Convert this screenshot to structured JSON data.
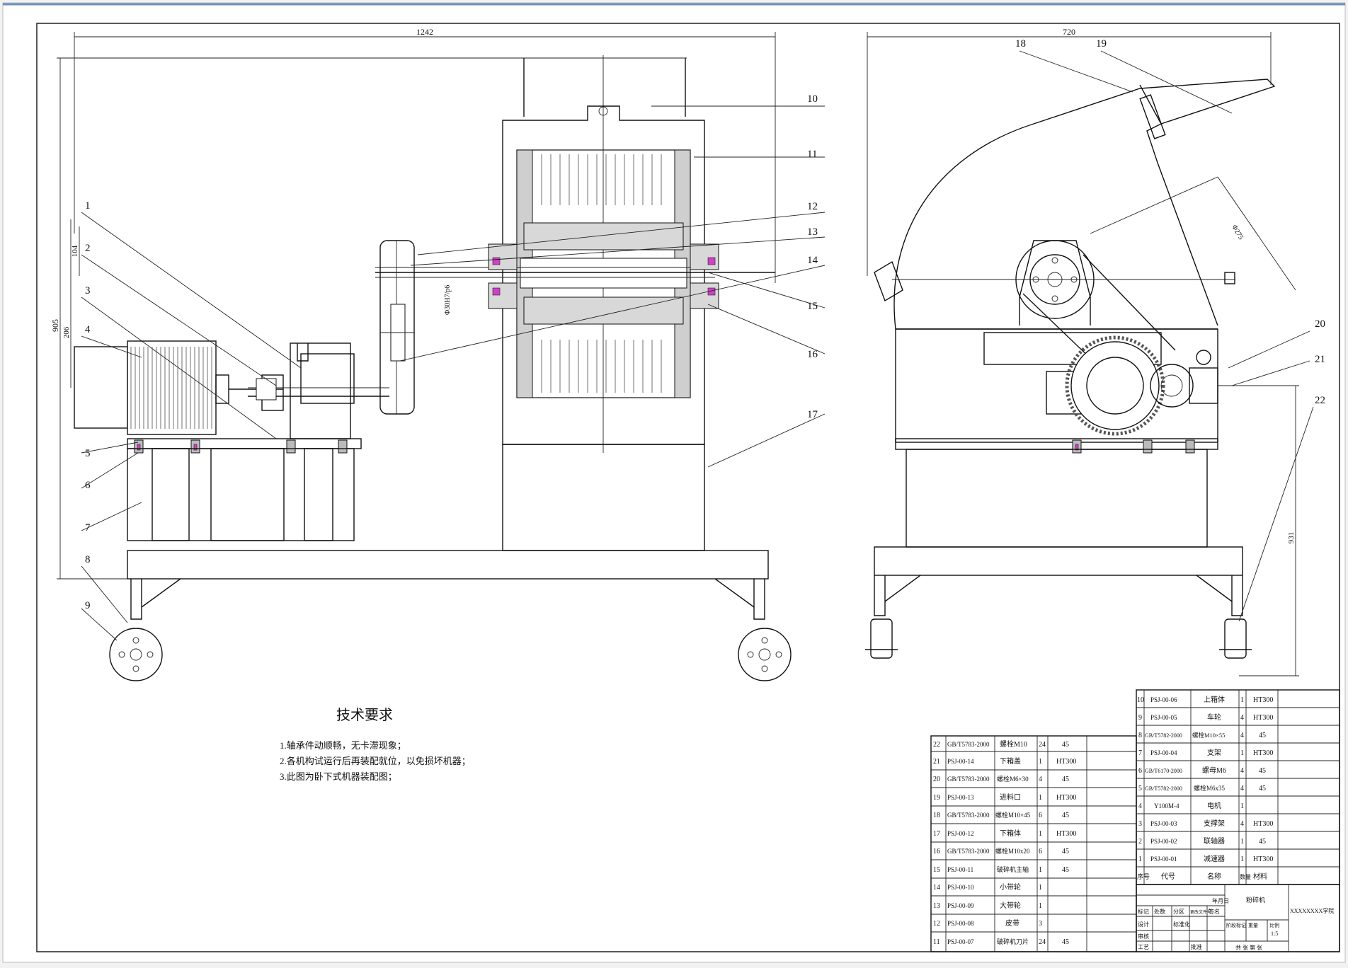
{
  "drawing": {
    "dims": {
      "overall_width": "1242",
      "right_width": "720",
      "total_height": "905",
      "motor_height": "206",
      "shaft_height": "104",
      "fit_lower": "Φ30H7/p6",
      "right_diag": "Φ275",
      "right_height": "931"
    },
    "balloons": [
      "1",
      "2",
      "3",
      "4",
      "5",
      "6",
      "7",
      "8",
      "9",
      "10",
      "11",
      "12",
      "13",
      "14",
      "15",
      "16",
      "17",
      "18",
      "19",
      "20",
      "21",
      "22"
    ],
    "tech_requirements": {
      "title": "技术要求",
      "items": [
        "1.轴承件动顺畅，无卡滞现象；",
        "2.各机构试运行后再装配就位，以免损坏机器；",
        "3.此图为卧下式机器装配图；"
      ]
    },
    "bom_left": [
      {
        "no": "22",
        "code": "GB/T5783-2000",
        "name": "螺栓M10",
        "qty": "24",
        "mat": "45"
      },
      {
        "no": "21",
        "code": "PSJ-00-14",
        "name": "下箱盖",
        "qty": "1",
        "mat": "HT300"
      },
      {
        "no": "20",
        "code": "GB/T5783-2000",
        "name": "螺栓M6×30",
        "qty": "4",
        "mat": "45"
      },
      {
        "no": "19",
        "code": "PSJ-00-13",
        "name": "进料口",
        "qty": "1",
        "mat": "HT300"
      },
      {
        "no": "18",
        "code": "GB/T5783-2000",
        "name": "螺栓M10×45",
        "qty": "6",
        "mat": "45"
      },
      {
        "no": "17",
        "code": "PSJ-00-12",
        "name": "下箱体",
        "qty": "1",
        "mat": "HT300"
      },
      {
        "no": "16",
        "code": "GB/T5783-2000",
        "name": "螺栓M10x20",
        "qty": "6",
        "mat": "45"
      },
      {
        "no": "15",
        "code": "PSJ-00-11",
        "name": "破碎机主轴",
        "qty": "1",
        "mat": "45"
      },
      {
        "no": "14",
        "code": "PSJ-00-10",
        "name": "小带轮",
        "qty": "1",
        "mat": ""
      },
      {
        "no": "13",
        "code": "PSJ-00-09",
        "name": "大带轮",
        "qty": "1",
        "mat": ""
      },
      {
        "no": "12",
        "code": "PSJ-00-08",
        "name": "皮带",
        "qty": "3",
        "mat": ""
      },
      {
        "no": "11",
        "code": "PSJ-00-07",
        "name": "破碎机刀片",
        "qty": "24",
        "mat": "45"
      }
    ],
    "bom_right": [
      {
        "no": "10",
        "code": "PSJ-00-06",
        "name": "上箱体",
        "qty": "1",
        "mat": "HT300"
      },
      {
        "no": "9",
        "code": "PSJ-00-05",
        "name": "车轮",
        "qty": "4",
        "mat": "HT300"
      },
      {
        "no": "8",
        "code": "GB/T5782-2000",
        "name": "螺栓M10×55",
        "qty": "4",
        "mat": "45"
      },
      {
        "no": "7",
        "code": "PSJ-00-04",
        "name": "支架",
        "qty": "1",
        "mat": "HT300"
      },
      {
        "no": "6",
        "code": "GB/T6170-2000",
        "name": "螺母M6",
        "qty": "4",
        "mat": "45"
      },
      {
        "no": "5",
        "code": "GB/T5782-2000",
        "name": "螺栓M6x35",
        "qty": "4",
        "mat": "45"
      },
      {
        "no": "4",
        "code": "Y100M-4",
        "name": "电机",
        "qty": "1",
        "mat": ""
      },
      {
        "no": "3",
        "code": "PSJ-00-03",
        "name": "支撑架",
        "qty": "4",
        "mat": "HT300"
      },
      {
        "no": "2",
        "code": "PSJ-00-02",
        "name": "联轴器",
        "qty": "1",
        "mat": "45"
      },
      {
        "no": "1",
        "code": "PSJ-00-01",
        "name": "减速器",
        "qty": "1",
        "mat": "HT300"
      }
    ],
    "bom_header": {
      "no": "序号",
      "code": "代号",
      "name": "名称",
      "qty": "数量",
      "mat": "材料"
    },
    "title_block": {
      "drawing_name": "粉碎机",
      "scale": "1:5",
      "sheet": "共 张 第 张",
      "school": "XXXXXXXX学院",
      "row_labels": [
        "标记",
        "处数",
        "分区",
        "更改文件号",
        "签名",
        "年月日"
      ],
      "role_labels": [
        "设计",
        "审核",
        "工艺",
        "批准",
        "标准化"
      ],
      "stage_labels": [
        "阶段标记",
        "重量",
        "比例"
      ]
    }
  }
}
